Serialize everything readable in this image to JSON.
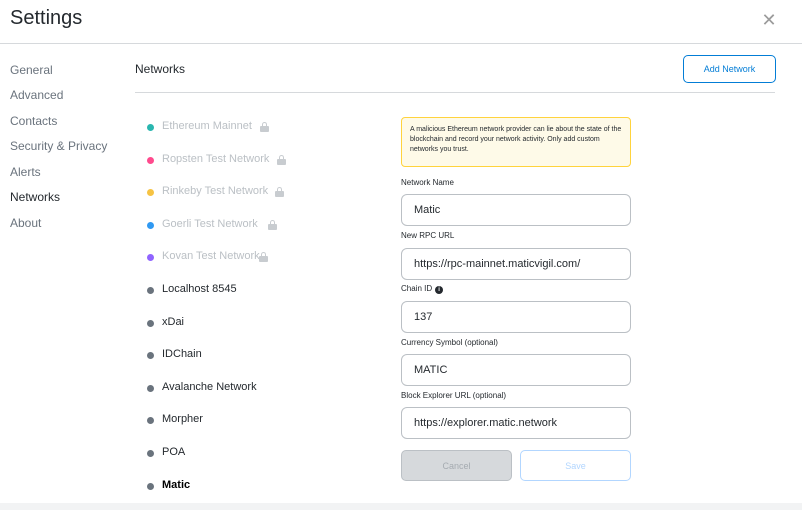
{
  "header": {
    "title": "Settings",
    "close_label": "✕"
  },
  "sidebar": {
    "items": [
      {
        "label": "General"
      },
      {
        "label": "Advanced"
      },
      {
        "label": "Contacts"
      },
      {
        "label": "Security & Privacy"
      },
      {
        "label": "Alerts"
      },
      {
        "label": "Networks",
        "active": true
      },
      {
        "label": "About"
      }
    ]
  },
  "main": {
    "title": "Networks",
    "add_network_label": "Add Network",
    "networks": [
      {
        "name": "Ethereum Mainnet",
        "color": "#29b6af",
        "locked": true
      },
      {
        "name": "Ropsten Test Network",
        "color": "#ff4a8d",
        "locked": true
      },
      {
        "name": "Rinkeby Test Network",
        "color": "#f6c343",
        "locked": true
      },
      {
        "name": "Goerli Test Network",
        "color": "#3099f2",
        "locked": true
      },
      {
        "name": "Kovan Test Network",
        "color": "#9064ff",
        "locked": true
      },
      {
        "name": "Localhost 8545",
        "color": "#6a737d",
        "locked": false
      },
      {
        "name": "xDai",
        "color": "#6a737d",
        "locked": false
      },
      {
        "name": "IDChain",
        "color": "#6a737d",
        "locked": false
      },
      {
        "name": "Avalanche Network",
        "color": "#6a737d",
        "locked": false
      },
      {
        "name": "Morpher",
        "color": "#6a737d",
        "locked": false
      },
      {
        "name": "POA",
        "color": "#6a737d",
        "locked": false
      },
      {
        "name": "Matic",
        "color": "#6a737d",
        "locked": false,
        "selected": true
      }
    ]
  },
  "form": {
    "warning": "A malicious Ethereum network provider can lie about the state of the blockchain and record your network activity. Only add custom networks you trust.",
    "network_name": {
      "label": "Network Name",
      "value": "Matic"
    },
    "rpc_url": {
      "label": "New RPC URL",
      "value": "https://rpc-mainnet.maticvigil.com/"
    },
    "chain_id": {
      "label": "Chain ID",
      "info_icon": "info-icon",
      "info_glyph": "i",
      "value": "137"
    },
    "currency_symbol": {
      "label": "Currency Symbol (optional)",
      "value": "MATIC"
    },
    "block_explorer": {
      "label": "Block Explorer URL (optional)",
      "value": "https://explorer.matic.network"
    },
    "cancel_label": "Cancel",
    "save_label": "Save"
  }
}
